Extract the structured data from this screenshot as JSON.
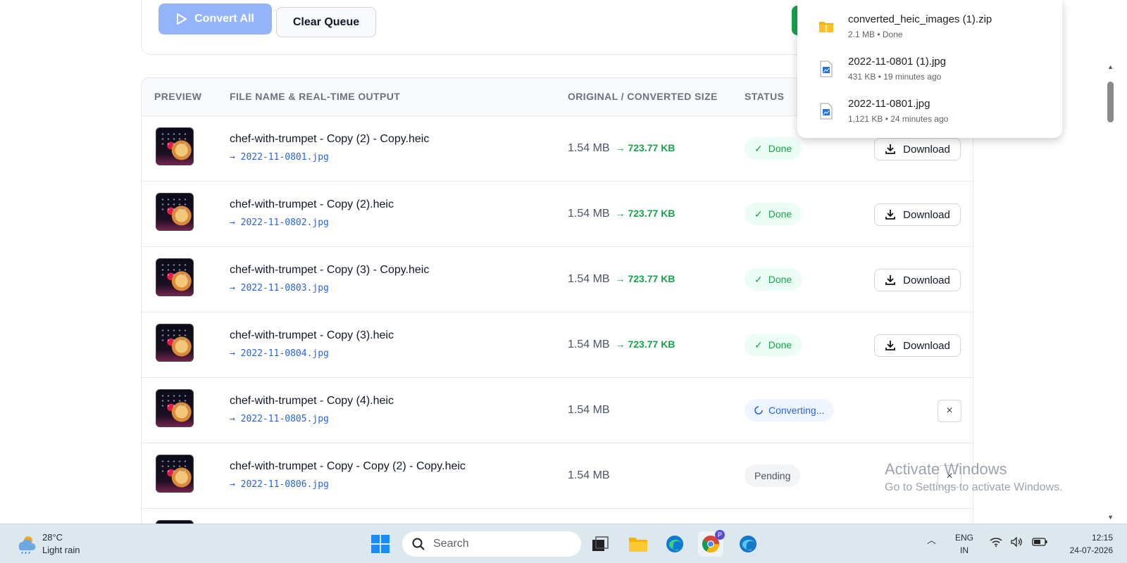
{
  "toolbar": {
    "convert_all_label": "Convert All",
    "clear_queue_label": "Clear Queue"
  },
  "table": {
    "headers": [
      "PREVIEW",
      "FILE NAME & REAL-TIME OUTPUT",
      "ORIGINAL / CONVERTED SIZE",
      "STATUS"
    ],
    "rows": [
      {
        "file": "chef-with-trumpet - Copy (2) - Copy.heic",
        "output": "→ 2022-11-0801.jpg",
        "original": "1.54 MB",
        "converted": "→ 723.77 KB",
        "status": "Done",
        "action": "Download"
      },
      {
        "file": "chef-with-trumpet - Copy (2).heic",
        "output": "→ 2022-11-0802.jpg",
        "original": "1.54 MB",
        "converted": "→ 723.77 KB",
        "status": "Done",
        "action": "Download"
      },
      {
        "file": "chef-with-trumpet - Copy (3) - Copy.heic",
        "output": "→ 2022-11-0803.jpg",
        "original": "1.54 MB",
        "converted": "→ 723.77 KB",
        "status": "Done",
        "action": "Download"
      },
      {
        "file": "chef-with-trumpet - Copy (3).heic",
        "output": "→ 2022-11-0804.jpg",
        "original": "1.54 MB",
        "converted": "→ 723.77 KB",
        "status": "Done",
        "action": "Download"
      },
      {
        "file": "chef-with-trumpet - Copy (4).heic",
        "output": "→ 2022-11-0805.jpg",
        "original": "1.54 MB",
        "converted": "",
        "status": "Converting...",
        "action": "×"
      },
      {
        "file": "chef-with-trumpet - Copy - Copy (2) - Copy.heic",
        "output": "→ 2022-11-0806.jpg",
        "original": "1.54 MB",
        "converted": "",
        "status": "Pending",
        "action": "×"
      }
    ]
  },
  "downloads": {
    "items": [
      {
        "name": "converted_heic_images (1).zip",
        "meta": "2.1 MB • Done",
        "icon": "zip-folder-icon"
      },
      {
        "name": "2022-11-0801 (1).jpg",
        "meta": "431 KB • 19 minutes ago",
        "icon": "image-file-icon"
      },
      {
        "name": "2022-11-0801.jpg",
        "meta": "1,121 KB • 24 minutes ago",
        "icon": "image-file-icon"
      }
    ]
  },
  "watermark": {
    "line1": "Activate Windows",
    "line2": "Go to Settings to activate Windows."
  },
  "taskbar": {
    "weather_temp": "28°C",
    "weather_desc": "Light rain",
    "search_placeholder": "Search",
    "lang_line1": "ENG",
    "lang_line2": "IN",
    "time": "12:15",
    "date": "24-07-2026",
    "chrome_badge": "P"
  },
  "colors": {
    "accent_blue": "#93b4f8",
    "done_green": "#16a34a",
    "link_blue": "#2563eb"
  }
}
